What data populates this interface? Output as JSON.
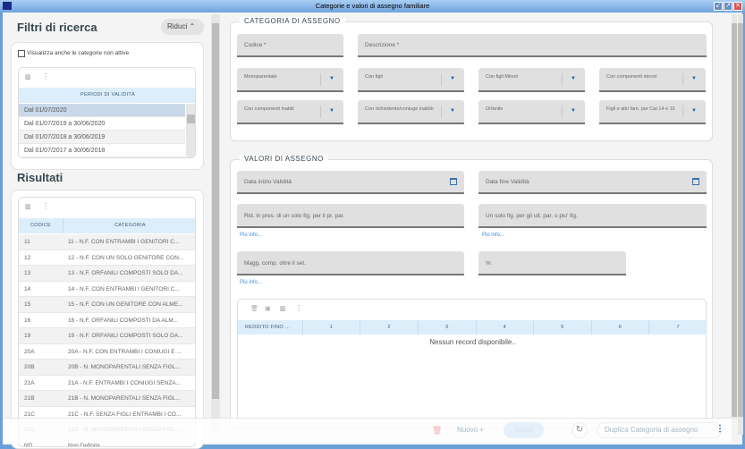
{
  "window": {
    "title": "Categorie e valori di assegno familiare",
    "controls": [
      "minimize",
      "maximize",
      "close"
    ]
  },
  "filters": {
    "title": "Filtri di ricerca",
    "collapse_label": "Riduci",
    "checkbox_label": "Visualizza anche le categorie non attive",
    "checkbox_checked": false,
    "periods_header": "PERIODI DI VALIDITÀ",
    "periods": [
      "Dal 01/07/2020",
      "Dal 01/07/2019 a 30/06/2020",
      "Dal 01/07/2018 a 30/06/2019",
      "Dal 01/07/2017 a 30/06/2018"
    ]
  },
  "results": {
    "title": "Risultati",
    "columns": [
      "CODICE",
      "CATEGORIA"
    ],
    "rows": [
      [
        "11",
        "11 - N.F. CON ENTRAMBI I GENITORI C..."
      ],
      [
        "12",
        "12 - N.F. CON UN SOLO GENITORE CON..."
      ],
      [
        "13",
        "13 - N.F. ORFANILI COMPOSTI SOLO DA..."
      ],
      [
        "14",
        "14 - N.F. CON ENTRAMBI I GENITORI C..."
      ],
      [
        "15",
        "15 - N.F. CON UN GENITORE CON ALME..."
      ],
      [
        "16",
        "16 - N.F. ORFANILI COMPOSTI DA ALM..."
      ],
      [
        "19",
        "19 - N.F. ORFANILI COMPOSTI SOLO DA..."
      ],
      [
        "20A",
        "20A - N.F. CON ENTRAMBI I CONIUGI E ..."
      ],
      [
        "20B",
        "20B - N. MONOPARENTALI SENZA FIGL..."
      ],
      [
        "21A",
        "21A - N.F. ENTRAMBI I CONIUGI SENZA..."
      ],
      [
        "21B",
        "21B - N. MONOPARENTALI SENZA FIGL..."
      ],
      [
        "21C",
        "21C - N.F. SENZA FIGLI ENTRAMBI I CO..."
      ],
      [
        "21D",
        "21D - N. MONOPARENTALI SENZA FIGL..."
      ],
      [
        "ND",
        "Non Definita"
      ]
    ]
  },
  "categoria": {
    "legend": "CATEGORIA DI ASSEGNO",
    "codice": "Codice *",
    "descrizione": "Descrizione *",
    "selects": [
      "Monoparentale",
      "Con figli",
      "Con figli Minori",
      "Con componenti minori",
      "Con componenti inabili",
      "Con richiedente/coniuge inabile",
      "Orfanile",
      "Figli e altri fam. per Cat 14 e 15"
    ]
  },
  "valori": {
    "legend": "VALORI DI ASSEGNO",
    "data_inizio": "Data inizio Validità",
    "data_fine": "Data fine Validità",
    "rid": "Rid. in pres. di un solo fig. per il pr. par.",
    "un_solo": "Un solo fig. per gli ult. par. o piu' fig.",
    "magg": "Magg. comp. oltre il set.",
    "perc": "%",
    "more_info": "Più info...",
    "table": {
      "columns": [
        "REDDITO FINO ...",
        "1",
        "2",
        "3",
        "4",
        "5",
        "6",
        "7"
      ],
      "empty": "Nessun record disponibile.."
    }
  },
  "footer": {
    "nuovo": "Nuovo",
    "salva": "Salva",
    "duplica": "Duplica Categoria di assegno"
  },
  "colors": {
    "titlebar": "#6fa4dd",
    "accent": "#1f5fa8",
    "grid_header": "#ddeefb",
    "selected_row": "#c9d9ea"
  }
}
